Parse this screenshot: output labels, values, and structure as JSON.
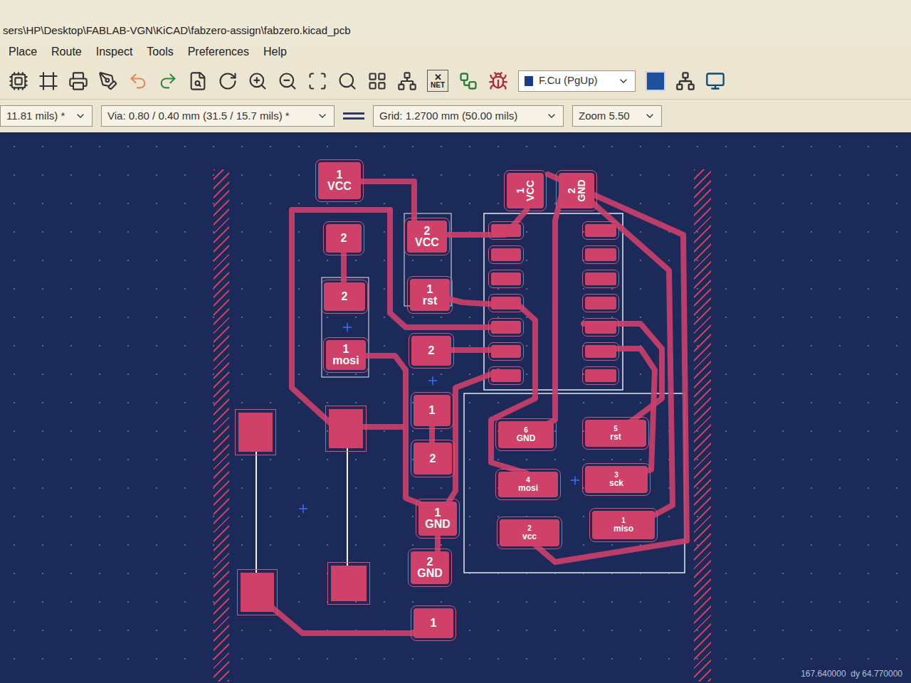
{
  "window": {
    "title": "sers\\HP\\Desktop\\FABLAB-VGN\\KiCAD\\fabzero-assign\\fabzero.kicad_pcb"
  },
  "menu": [
    "Place",
    "Route",
    "Inspect",
    "Tools",
    "Preferences",
    "Help"
  ],
  "toolbar": {
    "net_label": "NET",
    "layer": "F.Cu (PgUp)"
  },
  "options": {
    "track": "11.81 mils) *",
    "via": "Via: 0.80 / 0.40 mm (31.5 / 15.7 mils) *",
    "grid": "Grid: 1.2700 mm (50.00 mils)",
    "zoom": "Zoom 5.50"
  },
  "pads": [
    {
      "number": "1",
      "net": "VCC",
      "kind": "pad"
    },
    {
      "number": "2",
      "net": "",
      "kind": "pad"
    },
    {
      "number": "2",
      "net": "",
      "kind": "pad"
    },
    {
      "number": "1",
      "net": "mosi",
      "kind": "pad"
    },
    {
      "number": "2",
      "net": "VCC",
      "kind": "pad"
    },
    {
      "number": "1",
      "net": "rst",
      "kind": "pad"
    },
    {
      "number": "2",
      "net": "",
      "kind": "pad"
    },
    {
      "number": "1",
      "net": "",
      "kind": "pad"
    },
    {
      "number": "2",
      "net": "",
      "kind": "pad"
    },
    {
      "number": "1",
      "net": "GND",
      "kind": "pad"
    },
    {
      "number": "2",
      "net": "GND",
      "kind": "pad"
    },
    {
      "number": "1",
      "net": "",
      "kind": "pad"
    },
    {
      "number": "1",
      "net": "VCC",
      "kind": "rotated"
    },
    {
      "number": "2",
      "net": "GND",
      "kind": "rotated"
    },
    {
      "number": "6",
      "net": "GND",
      "kind": "header"
    },
    {
      "number": "5",
      "net": "rst",
      "kind": "header"
    },
    {
      "number": "4",
      "net": "mosi",
      "kind": "header"
    },
    {
      "number": "3",
      "net": "sck",
      "kind": "header"
    },
    {
      "number": "2",
      "net": "vcc",
      "kind": "header"
    },
    {
      "number": "1",
      "net": "miso",
      "kind": "header"
    }
  ],
  "status": {
    "coords": "167.640000  dy 64.770000"
  }
}
